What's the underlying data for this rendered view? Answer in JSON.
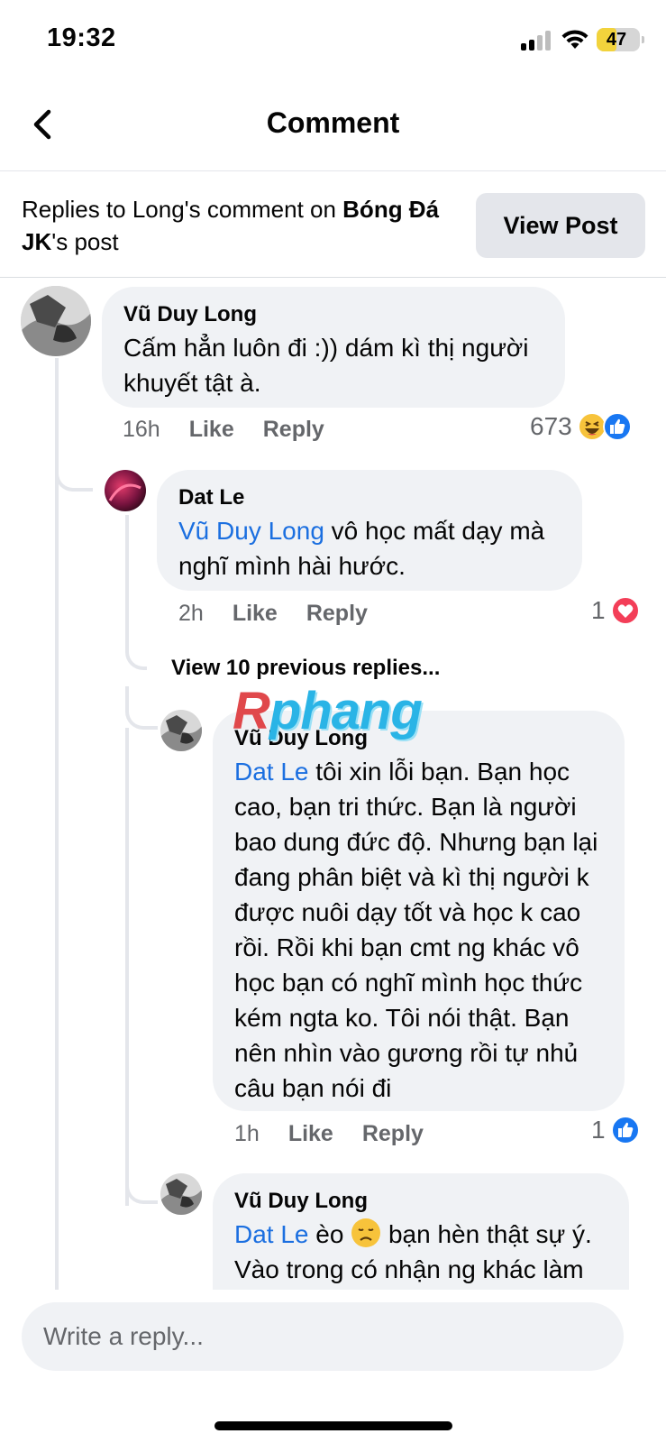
{
  "status_bar": {
    "time": "19:32",
    "battery": "47"
  },
  "header": {
    "title": "Comment"
  },
  "context": {
    "prefix": "Replies to Long's comment on ",
    "page_name": "Bóng Đá JK",
    "suffix": "'s post",
    "view_post_label": "View Post"
  },
  "comments": [
    {
      "author": "Vũ Duy Long",
      "mention": "",
      "text": "Cấm hẳn luôn đi :)) dám kì thị người khuyết tật à.",
      "time": "16h",
      "like_label": "Like",
      "reply_label": "Reply",
      "reaction_count": "673",
      "reactions": [
        "haha-icon",
        "like-icon"
      ]
    },
    {
      "author": "Dat Le",
      "mention": "Vũ Duy Long",
      "text": " vô học mất dạy mà nghĩ mình hài hước.",
      "time": "2h",
      "like_label": "Like",
      "reply_label": "Reply",
      "reaction_count": "1",
      "reactions": [
        "love-icon"
      ]
    },
    {
      "author": "Vũ Duy Long",
      "mention": "Dat Le",
      "text": " tôi xin lỗi bạn. Bạn học cao, bạn tri thức. Bạn là người bao dung đức độ. Nhưng bạn lại đang phân biệt và kì thị người k được nuôi dạy tốt và học k cao rồi. Rồi khi bạn cmt ng khác vô học bạn có nghĩ mình học thức kém ngta ko. Tôi nói thật. Bạn nên nhìn vào gương rồi tự nhủ câu bạn nói đi",
      "time": "1h",
      "like_label": "Like",
      "reply_label": "Reply",
      "reaction_count": "1",
      "reactions": [
        "like-icon"
      ]
    },
    {
      "author": "Vũ Duy Long",
      "mention": "Dat Le",
      "text_before_emoji": " èo ",
      "text_after_emoji": " bạn hèn thật sự ý. Vào trong có nhận ng khác làm"
    }
  ],
  "view_previous": "View 10 previous replies...",
  "watermark": {
    "first_letter": "R",
    "rest": "phang"
  },
  "composer": {
    "placeholder": "Write a reply..."
  },
  "colors": {
    "mention": "#1b6fe0",
    "bubble": "#f0f2f5",
    "like_blue": "#1877f2",
    "love_red": "#f33e58"
  }
}
